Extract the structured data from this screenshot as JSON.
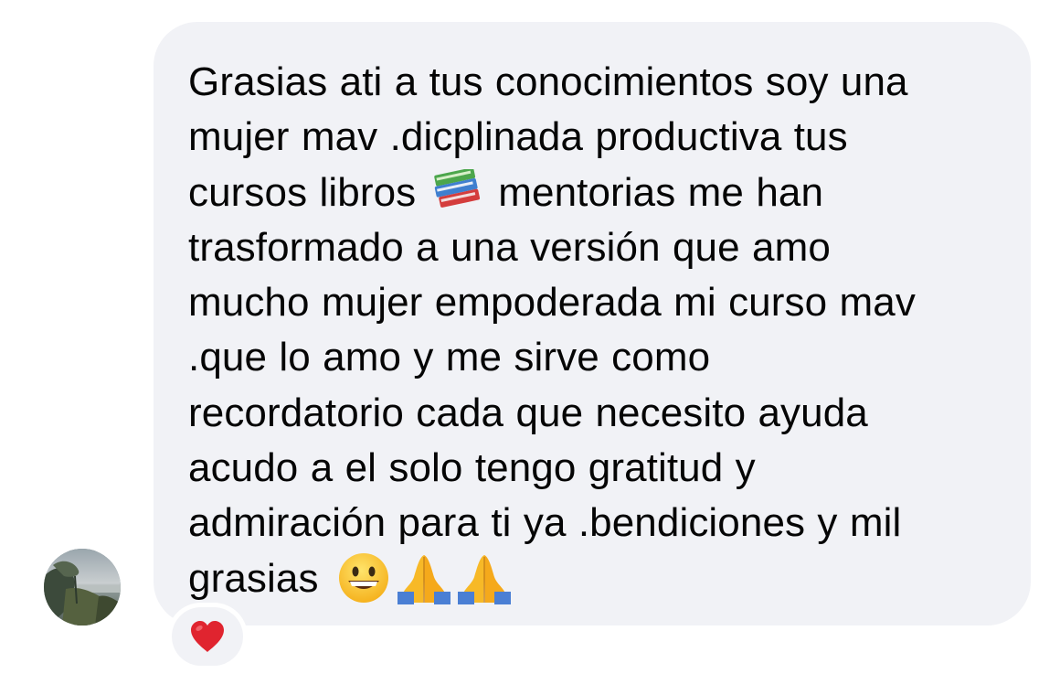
{
  "message": {
    "sender_avatar_icon": "contact-avatar-photo",
    "lines": [
      "Grasias ati a tus conocimientos soy una",
      "mujer mav .dicplinada productiva tus",
      "cursos libros",
      "mentorias me han",
      "trasformado a una versión que amo",
      "mucho mujer empoderada mi curso mav",
      ".que lo amo y me sirve como",
      "recordatorio cada que necesito ayuda",
      "acudo a el solo tengo gratitud y",
      "admiración para ti ya .bendiciones y mil",
      "grasias"
    ],
    "inline_emojis": [
      "books-emoji",
      "grinning-face-emoji",
      "folded-hands-emoji",
      "folded-hands-emoji"
    ]
  },
  "reaction": {
    "icon": "red-heart-icon",
    "color": "#e0242f"
  },
  "colors": {
    "bubble": "#f1f2f6",
    "text": "#050505",
    "background": "#ffffff"
  }
}
